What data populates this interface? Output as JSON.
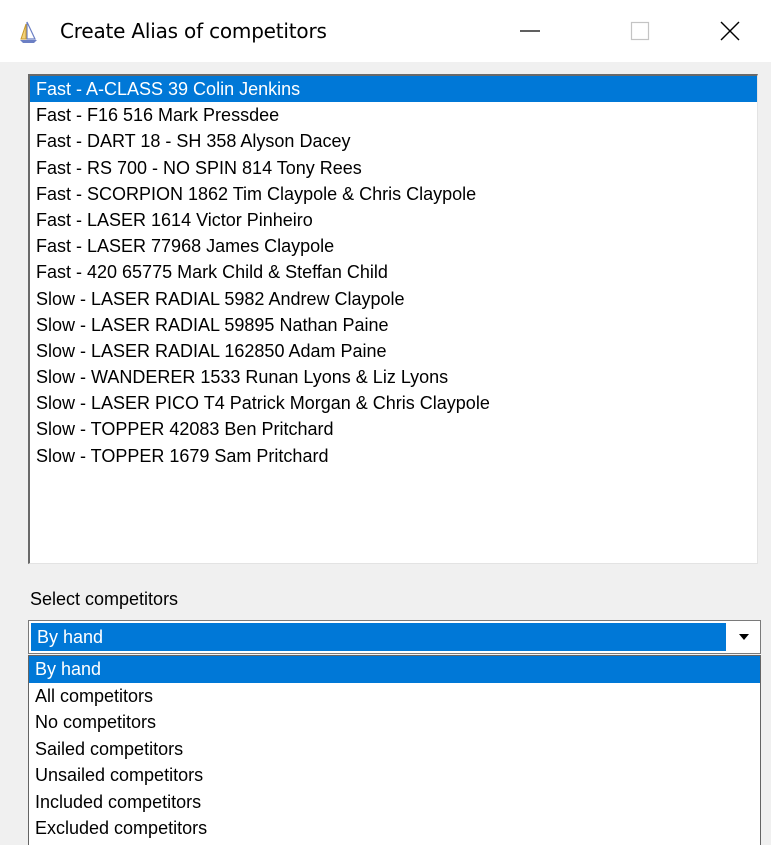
{
  "window": {
    "title": "Create Alias of competitors",
    "icon": "sailboat-icon"
  },
  "competitors": [
    {
      "label": "Fast - A-CLASS 39 Colin Jenkins",
      "selected": true
    },
    {
      "label": "Fast - F16 516 Mark Pressdee",
      "selected": false
    },
    {
      "label": "Fast - DART 18 - SH 358 Alyson Dacey",
      "selected": false
    },
    {
      "label": "Fast - RS 700 - NO SPIN 814 Tony Rees",
      "selected": false
    },
    {
      "label": "Fast - SCORPION 1862 Tim Claypole & Chris Claypole",
      "selected": false
    },
    {
      "label": "Fast - LASER 1614 Victor Pinheiro",
      "selected": false
    },
    {
      "label": "Fast - LASER 77968 James Claypole",
      "selected": false
    },
    {
      "label": "Fast - 420 65775 Mark Child & Steffan Child",
      "selected": false
    },
    {
      "label": "Slow - LASER RADIAL 5982 Andrew Claypole",
      "selected": false
    },
    {
      "label": "Slow - LASER RADIAL 59895 Nathan Paine",
      "selected": false
    },
    {
      "label": "Slow - LASER RADIAL 162850 Adam Paine",
      "selected": false
    },
    {
      "label": "Slow - WANDERER 1533 Runan Lyons & Liz Lyons",
      "selected": false
    },
    {
      "label": "Slow - LASER PICO T4 Patrick Morgan & Chris Claypole",
      "selected": false
    },
    {
      "label": "Slow - TOPPER 42083 Ben Pritchard",
      "selected": false
    },
    {
      "label": "Slow - TOPPER 1679 Sam Pritchard",
      "selected": false
    }
  ],
  "select": {
    "label": "Select competitors",
    "value": "By hand",
    "options": [
      {
        "label": "By hand",
        "selected": true
      },
      {
        "label": "All competitors",
        "selected": false
      },
      {
        "label": "No competitors",
        "selected": false
      },
      {
        "label": "Sailed competitors",
        "selected": false
      },
      {
        "label": "Unsailed competitors",
        "selected": false
      },
      {
        "label": "Included competitors",
        "selected": false
      },
      {
        "label": "Excluded competitors",
        "selected": false
      }
    ]
  },
  "colors": {
    "selection": "#0078d7",
    "window_bg": "#f0f0f0"
  }
}
